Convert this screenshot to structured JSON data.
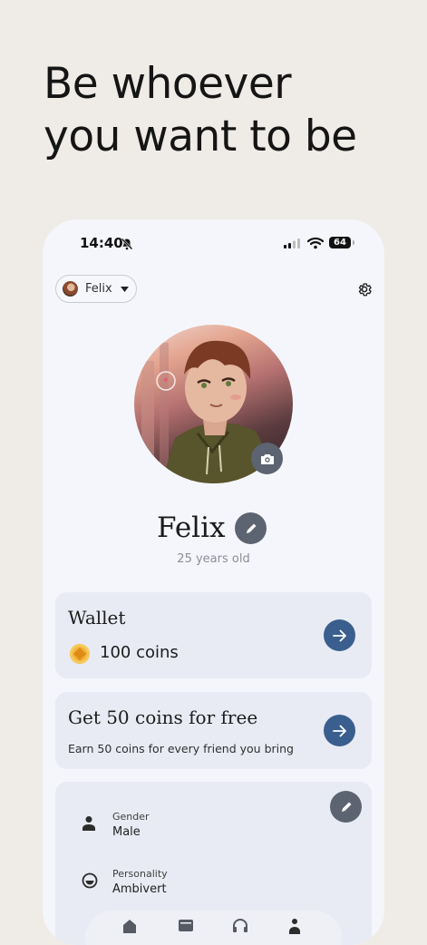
{
  "headline": {
    "line1": "Be whoever",
    "line2": "you want to be"
  },
  "status_bar": {
    "time": "14:40",
    "battery": "64"
  },
  "header": {
    "user_name": "Felix"
  },
  "profile": {
    "name": "Felix",
    "age_text": "25 years old"
  },
  "wallet": {
    "title": "Wallet",
    "coins_text": "100 coins"
  },
  "free_coins": {
    "title": "Get 50 coins for free",
    "subtitle": "Earn 50 coins for every friend you bring"
  },
  "info": {
    "gender_label": "Gender",
    "gender_value": "Male",
    "personality_label": "Personality",
    "personality_value": "Ambivert"
  },
  "colors": {
    "accent": "#3a5f8e",
    "neutral_button": "#5c6371",
    "card": "#e8ebf4",
    "background": "#efebe7"
  },
  "icons": [
    "bell-slash-icon",
    "signal-icon",
    "wifi-icon",
    "chevron-down-icon",
    "gear-icon",
    "camera-icon",
    "pencil-icon",
    "coin-icon",
    "arrow-right-icon",
    "person-icon",
    "smile-icon",
    "home-icon",
    "chat-icon",
    "headphones-icon",
    "profile-icon"
  ]
}
